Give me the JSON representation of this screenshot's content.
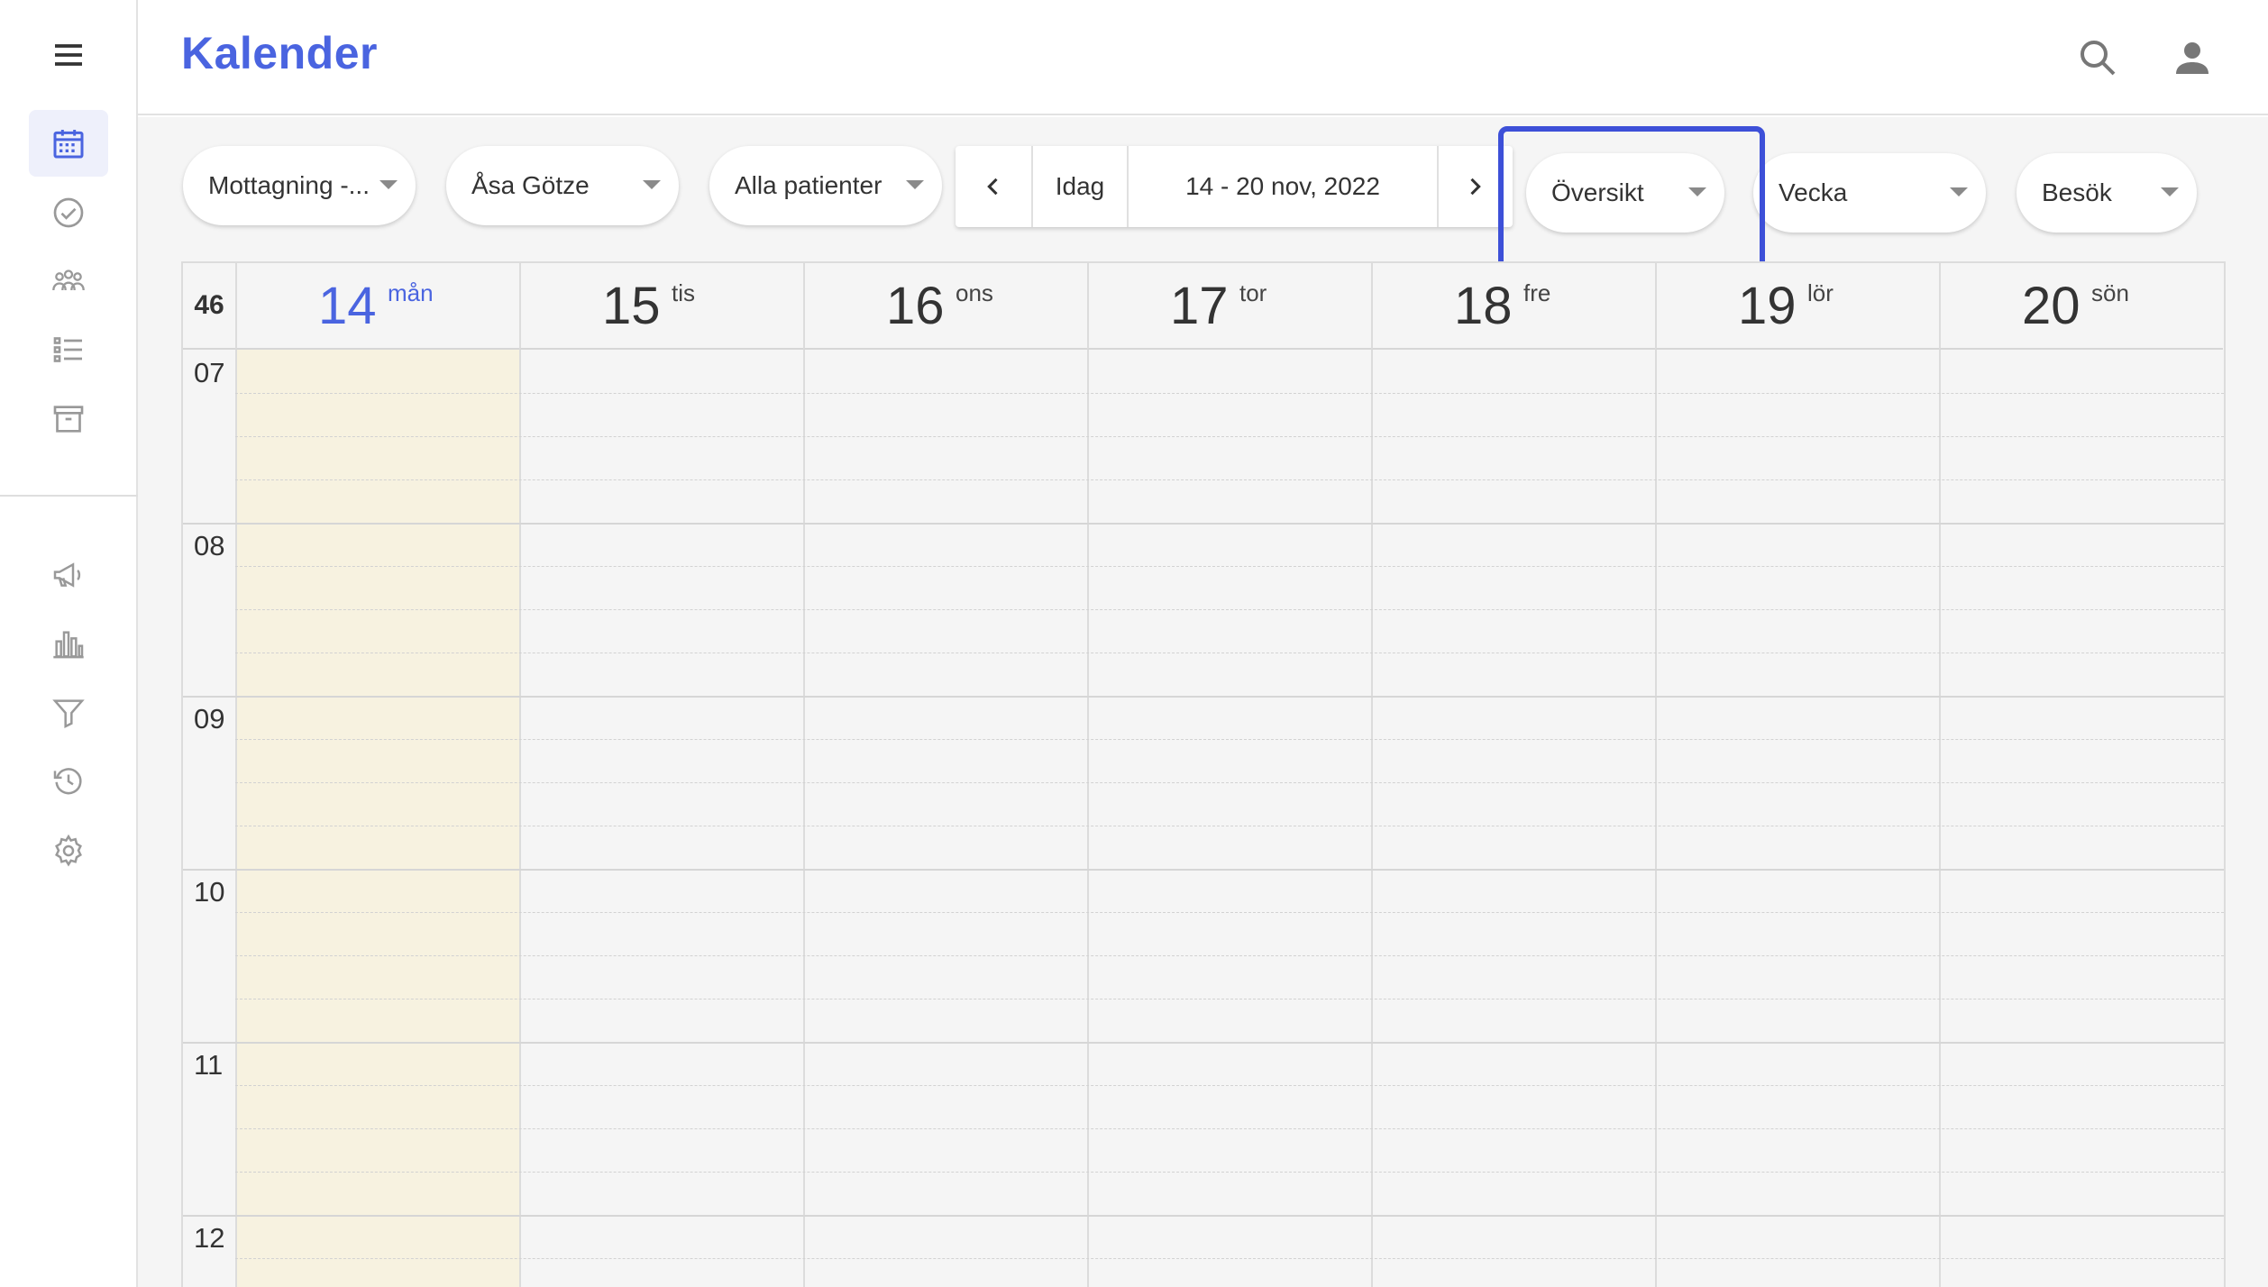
{
  "header": {
    "title": "Kalender"
  },
  "toolbar": {
    "reception": "Mottagning -...",
    "practitioner": "Åsa Götze",
    "patients": "Alla patienter",
    "today_label": "Idag",
    "date_range": "14 - 20 nov, 2022",
    "overview": "Översikt",
    "view_mode": "Vecka",
    "visit_type": "Besök"
  },
  "calendar": {
    "week_number": "46",
    "days": [
      {
        "num": "14",
        "name": "mån",
        "today": true
      },
      {
        "num": "15",
        "name": "tis"
      },
      {
        "num": "16",
        "name": "ons"
      },
      {
        "num": "17",
        "name": "tor"
      },
      {
        "num": "18",
        "name": "fre"
      },
      {
        "num": "19",
        "name": "lör"
      },
      {
        "num": "20",
        "name": "sön"
      }
    ],
    "hours": [
      "07",
      "08",
      "09",
      "10",
      "11",
      "12"
    ]
  },
  "colors": {
    "accent": "#4a64e0",
    "highlight": "#3d50d8",
    "today_column": "#f7f2e0"
  },
  "icons": {
    "rail": [
      "menu-icon",
      "calendar-icon",
      "check-circle-icon",
      "group-icon",
      "list-icon",
      "archive-icon",
      "megaphone-icon",
      "bar-chart-icon",
      "filter-icon",
      "history-icon",
      "settings-icon"
    ],
    "top": [
      "search-icon",
      "user-icon"
    ]
  }
}
